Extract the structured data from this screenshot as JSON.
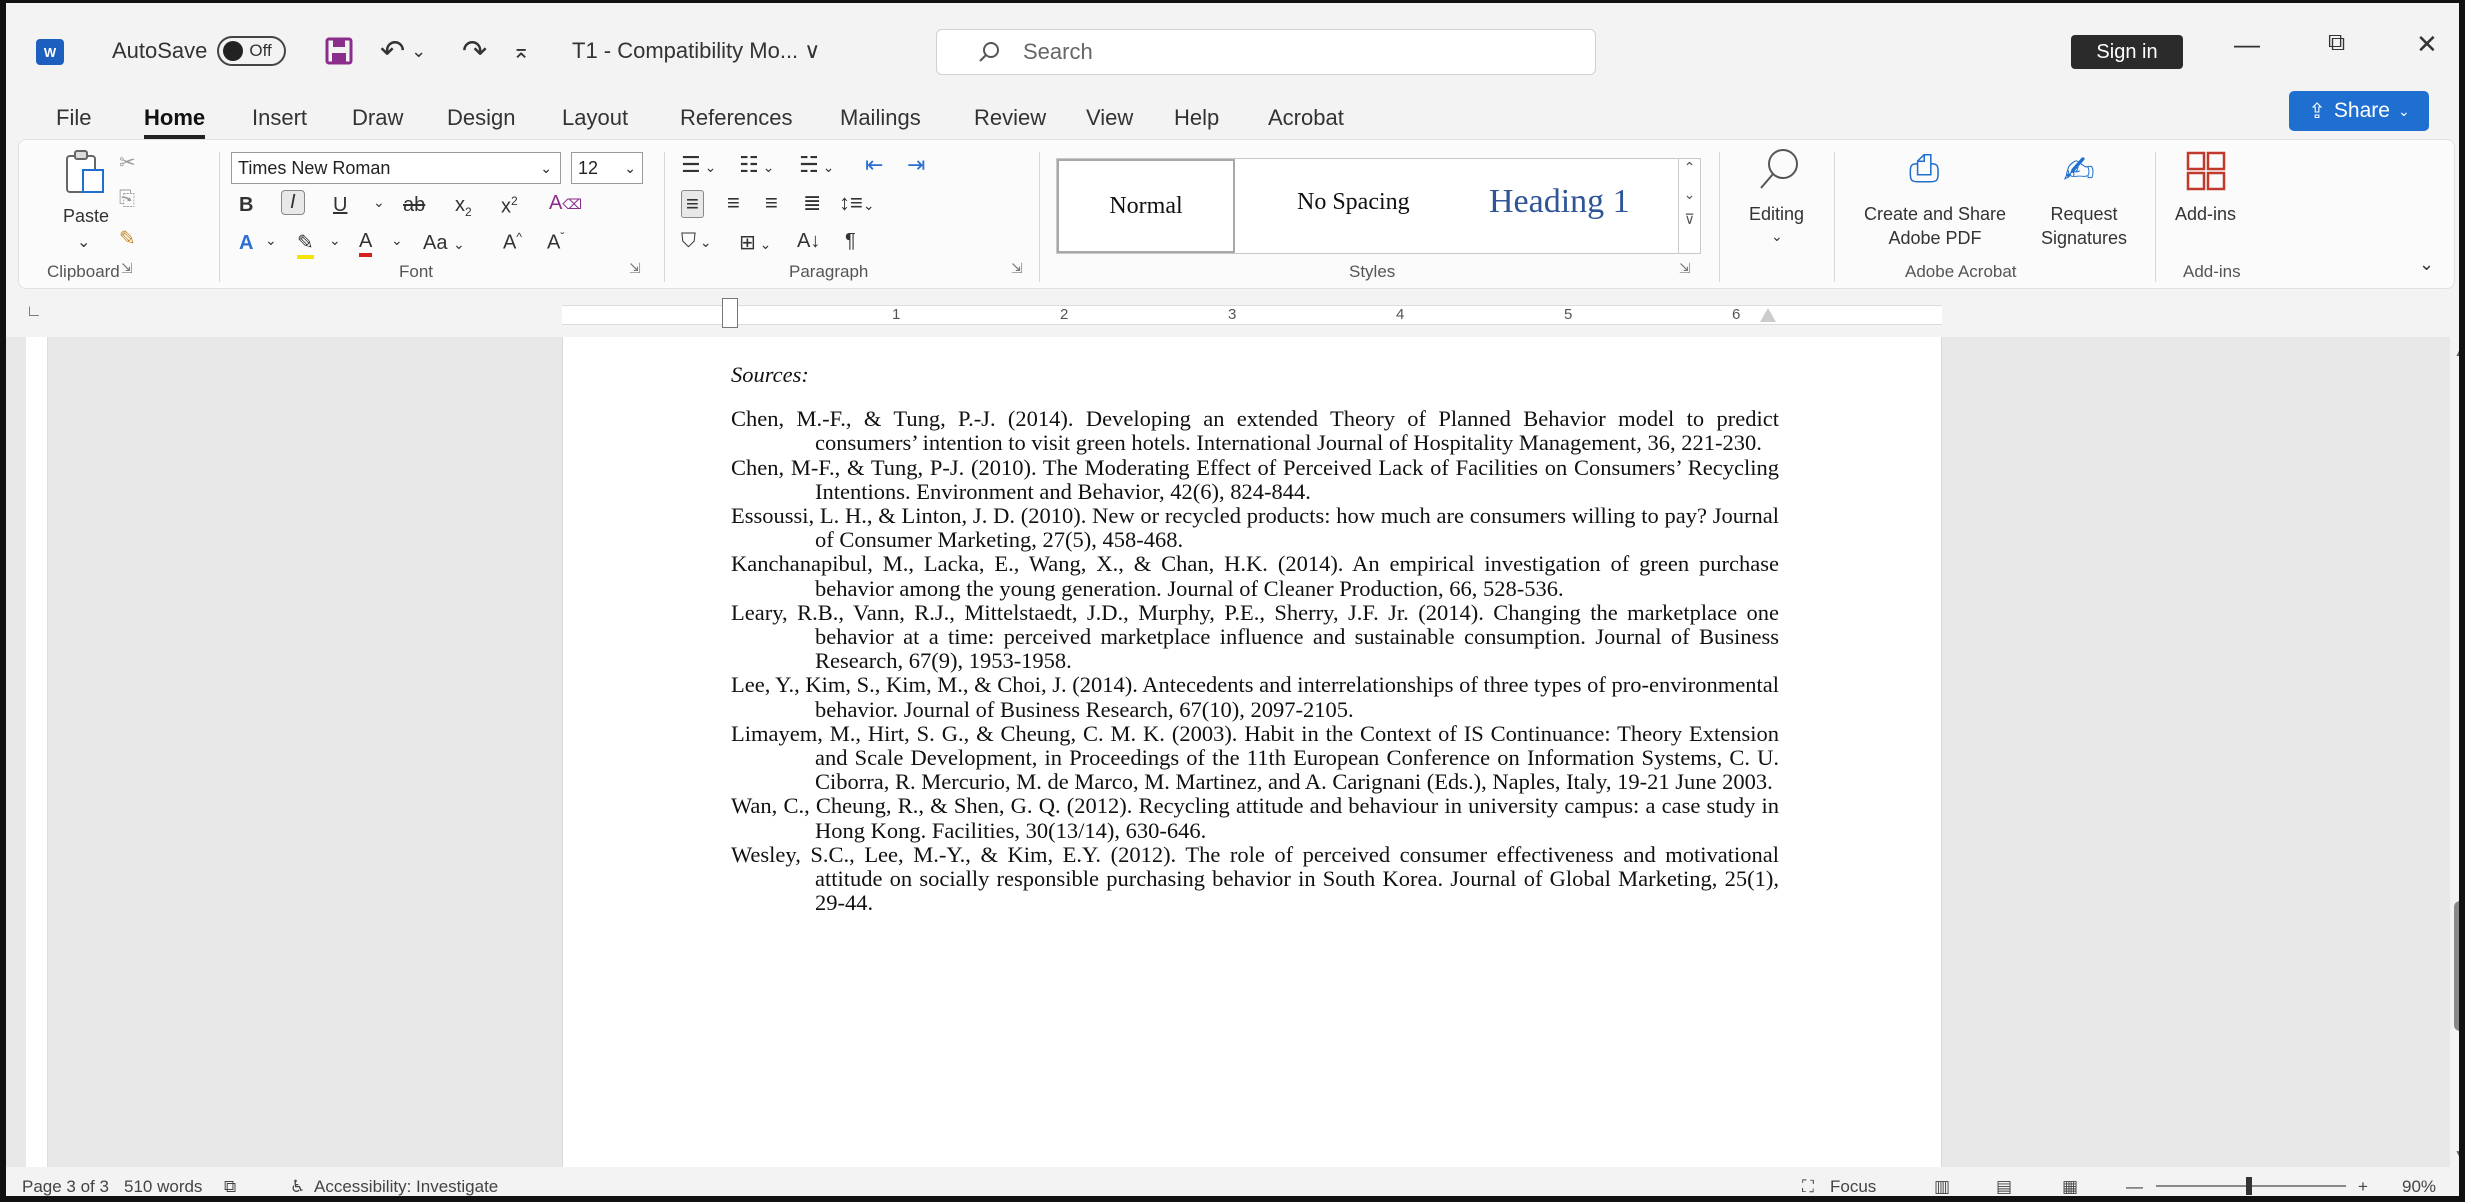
{
  "titlebar": {
    "autosave": "AutoSave",
    "autosave_state": "Off",
    "doc_title": "T1 - Compatibility Mo... ∨",
    "search_placeholder": "Search",
    "sign_in": "Sign in"
  },
  "menu": [
    "File",
    "Home",
    "Insert",
    "Draw",
    "Design",
    "Layout",
    "References",
    "Mailings",
    "Review",
    "View",
    "Help",
    "Acrobat"
  ],
  "share": "Share",
  "ribbon": {
    "clipboard": {
      "paste": "Paste",
      "label": "Clipboard"
    },
    "font": {
      "name": "Times New Roman",
      "size": "12",
      "label": "Font"
    },
    "paragraph": {
      "label": "Paragraph"
    },
    "styles": {
      "normal": "Normal",
      "no_spacing": "No Spacing",
      "heading1": "Heading 1",
      "label": "Styles"
    },
    "editing": {
      "label": "Editing"
    },
    "acrobat": {
      "create": "Create and Share\nAdobe PDF",
      "request": "Request\nSignatures",
      "label": "Adobe Acrobat"
    },
    "addins": {
      "button": "Add-ins",
      "label": "Add-ins"
    }
  },
  "ruler": [
    "1",
    "2",
    "3",
    "4",
    "5",
    "6"
  ],
  "document": {
    "heading": "Sources:",
    "references": [
      "Chen, M.-F., & Tung, P.-J. (2014). Developing an extended Theory of Planned Behavior model to predict consumers’ intention to visit green hotels. International Journal of Hospitality Management, 36, 221-230.",
      "Chen, M-F., & Tung, P-J. (2010). The Moderating Effect of Perceived Lack of Facilities on Consumers’ Recycling Intentions. Environment and Behavior, 42(6), 824-844.",
      "Essoussi, L. H., & Linton, J. D. (2010). New or recycled products: how much are consumers willing to pay? Journal of Consumer Marketing, 27(5), 458-468.",
      "Kanchanapibul, M., Lacka, E., Wang, X., & Chan, H.K. (2014). An empirical investigation of green purchase behavior among the young generation. Journal of Cleaner Production, 66, 528-536.",
      "Leary, R.B., Vann, R.J., Mittelstaedt, J.D., Murphy, P.E., Sherry, J.F. Jr. (2014). Changing the marketplace one behavior at a time: perceived marketplace influence and sustainable consumption. Journal of Business Research, 67(9), 1953-1958.",
      "Lee, Y., Kim, S., Kim, M., & Choi, J. (2014). Antecedents and interrelationships of three types of pro-environmental behavior. Journal of Business Research, 67(10), 2097-2105.",
      "Limayem, M., Hirt, S. G., & Cheung, C. M. K. (2003). Habit in the Context of IS Continuance: Theory Extension and Scale Development, in Proceedings of the 11th European Conference on Information Systems, C. U. Ciborra, R. Mercurio, M. de Marco, M. Martinez, and A. Carignani (Eds.), Naples, Italy, 19-21 June 2003.",
      "Wan, C., Cheung, R., & Shen, G. Q. (2012). Recycling attitude and behaviour in university campus: a case study in Hong Kong. Facilities, 30(13/14), 630-646.",
      "Wesley, S.C., Lee, M.-Y., & Kim, E.Y. (2012). The role of perceived consumer effectiveness and motivational attitude on socially responsible purchasing behavior in South Korea. Journal of Global Marketing, 25(1), 29-44."
    ]
  },
  "status": {
    "page": "Page 3 of 3",
    "words": "510 words",
    "accessibility": "Accessibility: Investigate",
    "focus": "Focus",
    "zoom": "90%"
  }
}
